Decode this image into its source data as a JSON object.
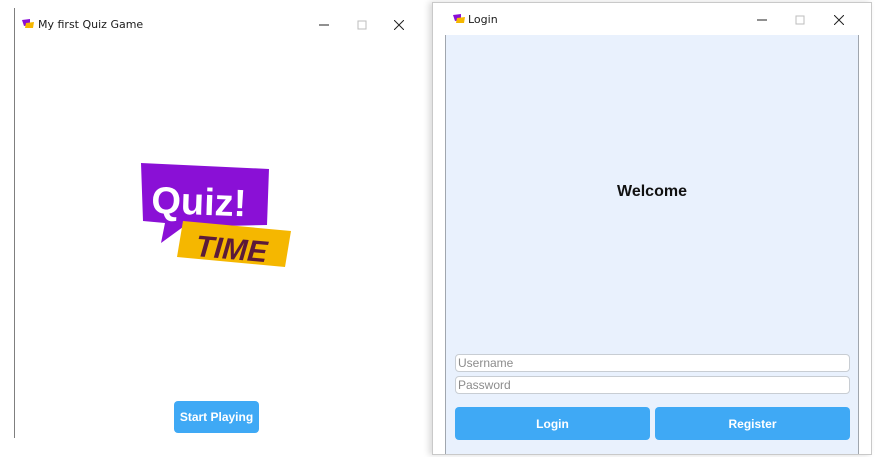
{
  "main_window": {
    "title": "My first Quiz Game",
    "controls": {
      "minimize": "minimize-icon",
      "maximize": "maximize-icon",
      "close": "close-icon"
    },
    "logo": {
      "line1": "Quiz!",
      "line2": "TIME",
      "colors": {
        "bubble": "#8a10d6",
        "banner": "#f5b700",
        "banner_text": "#5b1a3a"
      }
    },
    "start_button_label": "Start Playing"
  },
  "login_window": {
    "title": "Login",
    "controls": {
      "minimize": "minimize-icon",
      "maximize": "maximize-icon",
      "close": "close-icon"
    },
    "heading": "Welcome",
    "username": {
      "placeholder": "Username",
      "value": ""
    },
    "password": {
      "placeholder": "Password",
      "value": ""
    },
    "login_button_label": "Login",
    "register_button_label": "Register"
  },
  "colors": {
    "accent": "#3fa9f5",
    "login_background": "#e9f1fd"
  }
}
